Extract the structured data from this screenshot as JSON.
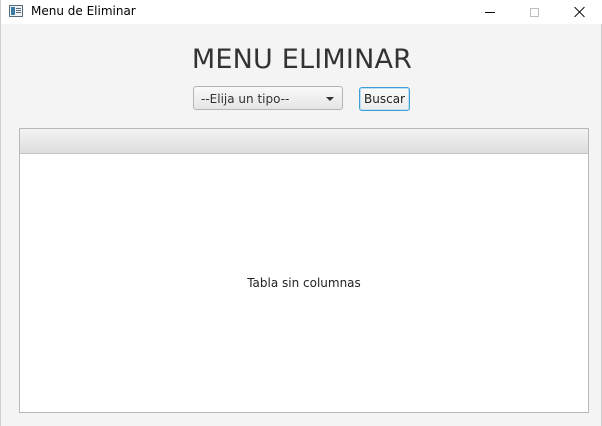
{
  "window": {
    "title": "Menu de Eliminar",
    "icon": "app-window-icon",
    "controls": {
      "minimize": "minimize-icon",
      "maximize": "maximize-icon",
      "close": "close-icon"
    }
  },
  "main": {
    "heading": "MENU ELIMINAR",
    "type_select": {
      "selected": "--Elija un tipo--"
    },
    "search_button": "Buscar",
    "table": {
      "placeholder": "Tabla sin columnas"
    }
  }
}
